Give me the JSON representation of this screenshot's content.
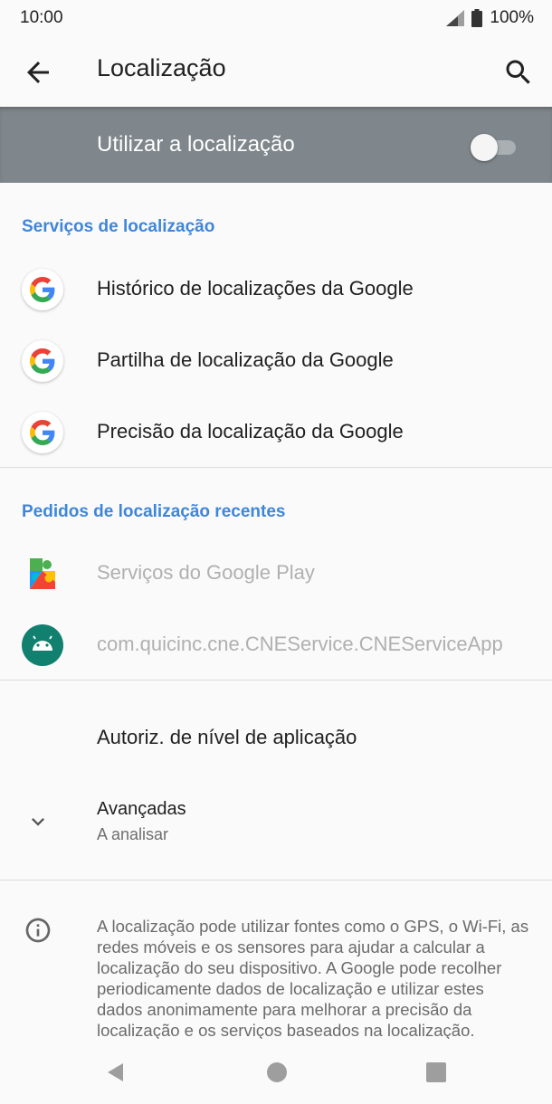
{
  "status_bar": {
    "time": "10:00",
    "battery": "100%"
  },
  "app_bar": {
    "title": "Localização"
  },
  "master_switch": {
    "label": "Utilizar a localização",
    "enabled": false
  },
  "location_services": {
    "header": "Serviços de localização",
    "items": [
      {
        "label": "Histórico de localizações da Google",
        "icon": "google-icon"
      },
      {
        "label": "Partilha de localização da Google",
        "icon": "google-icon"
      },
      {
        "label": "Precisão da localização da Google",
        "icon": "google-icon"
      }
    ]
  },
  "recent_requests": {
    "header": "Pedidos de localização recentes",
    "items": [
      {
        "label": "Serviços do Google Play",
        "icon": "google-play-services-icon"
      },
      {
        "label": "com.quicinc.cne.CNEService.CNEServiceApp",
        "icon": "android-icon"
      }
    ]
  },
  "app_permissions": {
    "label": "Autoriz. de nível de aplicação"
  },
  "advanced": {
    "title": "Avançadas",
    "subtitle": "A analisar"
  },
  "info": {
    "text": "A localização pode utilizar fontes como o GPS, o Wi-Fi, as redes móveis e os sensores para ajudar a calcular a localização do seu dispositivo. A Google pode recolher periodicamente dados de localização e utilizar estes dados anonimamente para melhorar a precisão da localização e os serviços baseados na localização."
  },
  "colors": {
    "accent": "#3f86d9",
    "master_bg": "#7f878c"
  }
}
